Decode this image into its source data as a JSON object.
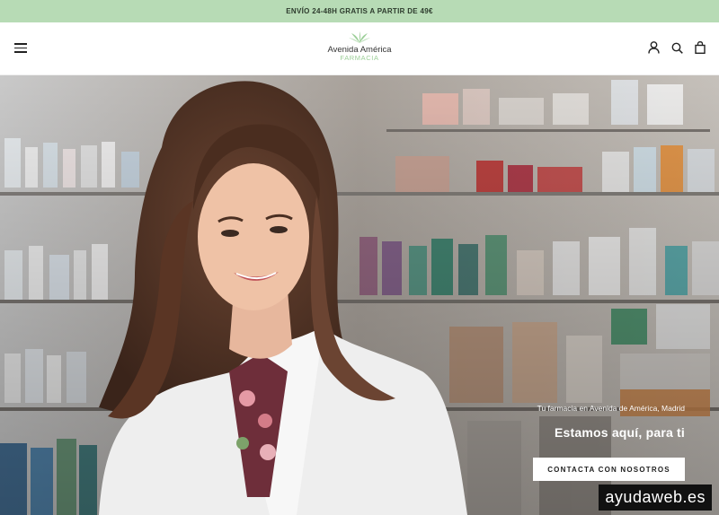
{
  "announcement": {
    "text": "ENVÍO 24-48H GRATIS A PARTIR DE 49€"
  },
  "header": {
    "logo_brand": "Avenida América",
    "logo_sub": "FARMACIA",
    "icons": [
      "menu-icon",
      "account-icon",
      "search-icon",
      "cart-icon"
    ]
  },
  "hero": {
    "kicker": "Tu farmacia en Avenida de América, Madrid",
    "headline": "Estamos aquí, para ti",
    "cta_label": "CONTACTA CON NOSOTROS"
  },
  "watermark": {
    "text": "ayudaweb.es"
  },
  "colors": {
    "announcement_bg": "#b7dbb5",
    "logo_accent": "#9ccf98",
    "text_dark": "#222222"
  }
}
